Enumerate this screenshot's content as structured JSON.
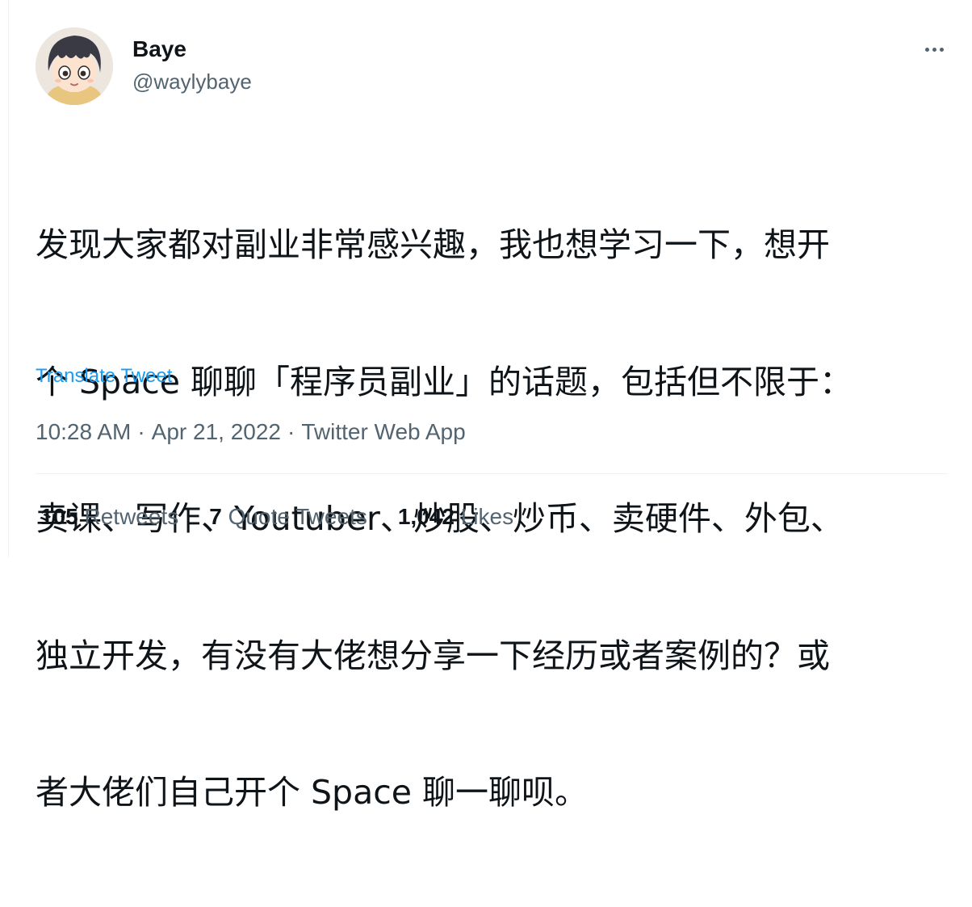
{
  "author": {
    "name": "Baye",
    "handle": "@waylybaye",
    "avatar_icon": "anime-boy-avatar"
  },
  "tweet": {
    "lines": [
      "发现大家都对副业非常感兴趣，我也想学习一下，想开",
      "个 Space 聊聊「程序员副业」的话题，包括但不限于：",
      "卖课、写作、Youtuber、炒股、炒币、卖硬件、外包、",
      "独立开发，有没有大佬想分享一下经历或者案例的？或",
      "者大佬们自己开个 Space 聊一聊呗。"
    ],
    "translate_label": "Translate Tweet"
  },
  "meta": {
    "time": "10:28 AM",
    "separator": "·",
    "date": "Apr 21, 2022",
    "source": "Twitter Web App"
  },
  "stats": {
    "retweets": {
      "count": "105",
      "label": "Retweets"
    },
    "quotes": {
      "count": "7",
      "label": "Quote Tweets"
    },
    "likes": {
      "count": "1,042",
      "label": "Likes"
    }
  },
  "colors": {
    "text": "#0f1419",
    "secondary": "#536471",
    "link": "#1d9bf0",
    "divider": "#eff3f4"
  }
}
